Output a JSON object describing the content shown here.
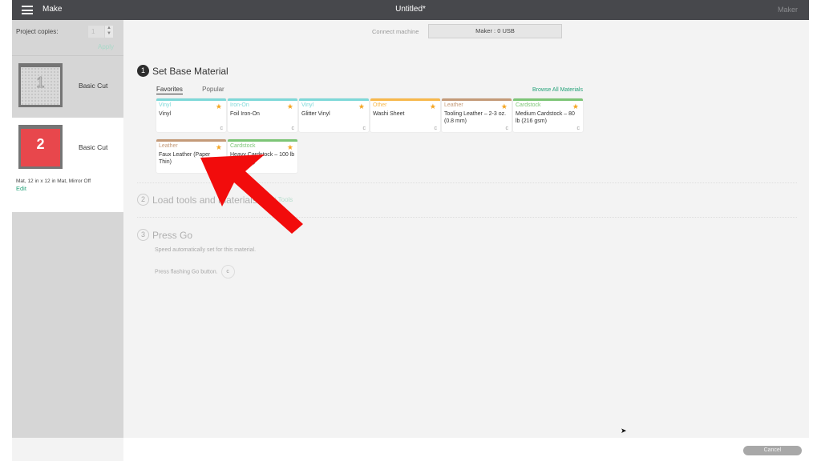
{
  "header": {
    "app_title": "Make",
    "document_title": "Untitled*",
    "machine_label": "Maker"
  },
  "sidebar": {
    "project_copies_label": "Project copies:",
    "project_copies_value": "1",
    "apply_label": "Apply",
    "mats": [
      {
        "number": "1",
        "label": "Basic Cut",
        "color": "#d9d9d9"
      },
      {
        "number": "2",
        "label": "Basic Cut",
        "color": "#e8474c",
        "info": "Mat, 12 in x 12 in Mat, Mirror Off",
        "edit_label": "Edit"
      }
    ]
  },
  "connect": {
    "label": "Connect machine",
    "value": "Maker : 0 USB"
  },
  "steps": [
    {
      "number": "1",
      "title": "Set Base Material"
    },
    {
      "number": "2",
      "title": "Load tools and materials",
      "link": "Edit Tools"
    },
    {
      "number": "3",
      "title": "Press Go",
      "notes": [
        "Speed automatically set for this material.",
        "Press flashing Go button."
      ],
      "go_icon": "c"
    }
  ],
  "material_tabs": [
    {
      "label": "Favorites",
      "active": true
    },
    {
      "label": "Popular",
      "active": false
    }
  ],
  "browse_all_label": "Browse All Materials",
  "materials": [
    {
      "category": "Vinyl",
      "name": "Vinyl",
      "color": "#7dd8d8",
      "star": "★",
      "icon": "c"
    },
    {
      "category": "Iron-On",
      "name": "Foil Iron-On",
      "color": "#7dd8d8",
      "star": "★",
      "icon": "c"
    },
    {
      "category": "Vinyl",
      "name": "Glitter Vinyl",
      "color": "#7dd8d8",
      "star": "★",
      "icon": "c"
    },
    {
      "category": "Other",
      "name": "Washi Sheet",
      "color": "#f7b84b",
      "star": "★",
      "icon": "c"
    },
    {
      "category": "Leather",
      "name": "Tooling Leather – 2-3 oz. (0.8 mm)",
      "color": "#c49a78",
      "star": "★",
      "icon": "c"
    },
    {
      "category": "Cardstock",
      "name": "Medium Cardstock – 80 lb (216 gsm)",
      "color": "#7cc576",
      "star": "★",
      "icon": "c"
    },
    {
      "category": "Leather",
      "name": "Faux Leather (Paper Thin)",
      "color": "#c49a78",
      "star": "★",
      "icon": ""
    },
    {
      "category": "Cardstock",
      "name": "Heavy Cardstock – 100 lb (270 gsm)",
      "color": "#7cc576",
      "star": "★",
      "icon": ""
    }
  ],
  "footer": {
    "cancel_label": "Cancel"
  }
}
